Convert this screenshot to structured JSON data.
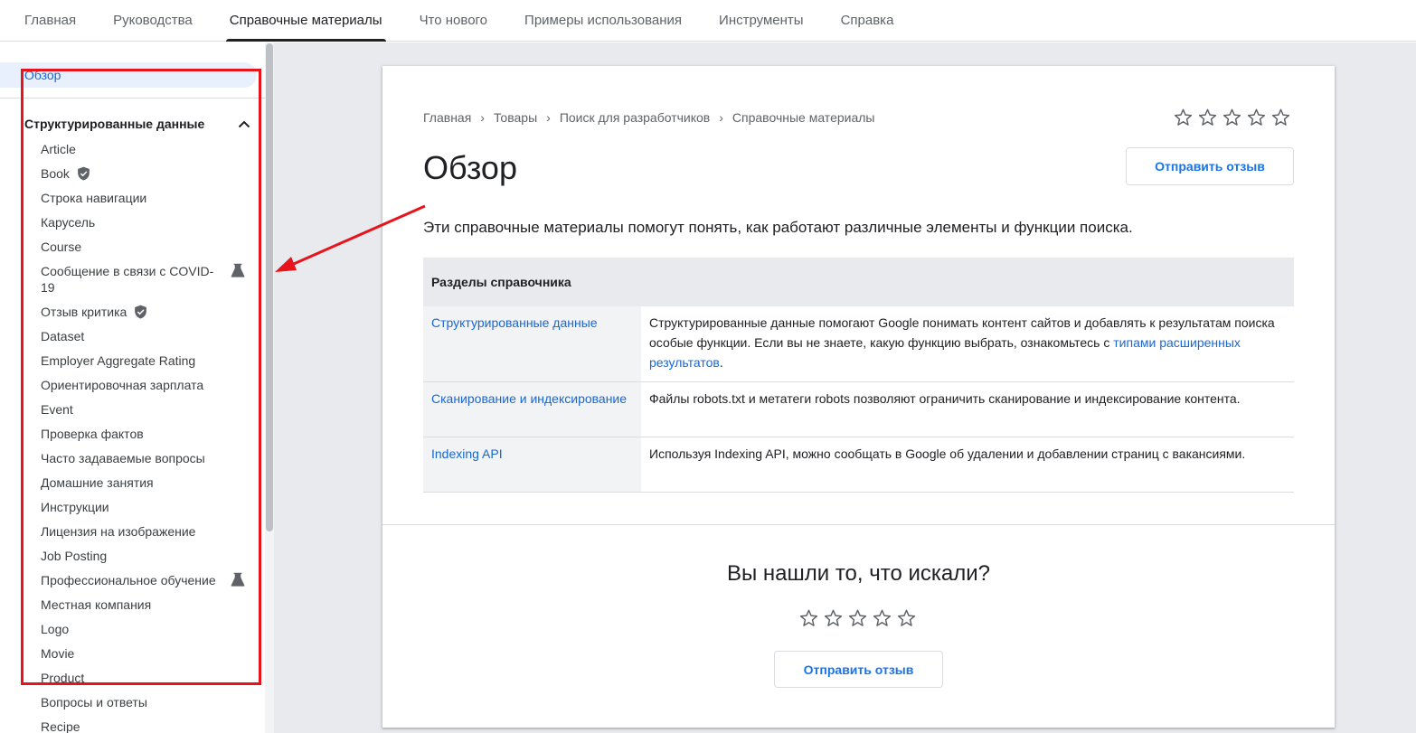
{
  "topnav": {
    "tabs": [
      {
        "label": "Главная",
        "active": false
      },
      {
        "label": "Руководства",
        "active": false
      },
      {
        "label": "Справочные материалы",
        "active": true
      },
      {
        "label": "Что нового",
        "active": false
      },
      {
        "label": "Примеры использования",
        "active": false
      },
      {
        "label": "Инструменты",
        "active": false
      },
      {
        "label": "Справка",
        "active": false
      }
    ]
  },
  "sidebar": {
    "overview_label": "Обзор",
    "section_title": "Структурированные данные",
    "items": [
      {
        "label": "Article",
        "icon": ""
      },
      {
        "label": "Book",
        "icon": "shield-check-icon"
      },
      {
        "label": "Строка навигации",
        "icon": ""
      },
      {
        "label": "Карусель",
        "icon": ""
      },
      {
        "label": "Course",
        "icon": ""
      },
      {
        "label": "Сообщение в связи с COVID-19",
        "icon": "beaker-icon"
      },
      {
        "label": "Отзыв критика",
        "icon": "shield-check-icon"
      },
      {
        "label": "Dataset",
        "icon": ""
      },
      {
        "label": "Employer Aggregate Rating",
        "icon": ""
      },
      {
        "label": "Ориентировочная зарплата",
        "icon": ""
      },
      {
        "label": "Event",
        "icon": ""
      },
      {
        "label": "Проверка фактов",
        "icon": ""
      },
      {
        "label": "Часто задаваемые вопросы",
        "icon": ""
      },
      {
        "label": "Домашние занятия",
        "icon": ""
      },
      {
        "label": "Инструкции",
        "icon": ""
      },
      {
        "label": "Лицензия на изображение",
        "icon": ""
      },
      {
        "label": "Job Posting",
        "icon": ""
      },
      {
        "label": "Профессиональное обучение",
        "icon": "beaker-icon"
      },
      {
        "label": "Местная компания",
        "icon": ""
      },
      {
        "label": "Logo",
        "icon": ""
      },
      {
        "label": "Movie",
        "icon": ""
      },
      {
        "label": "Product",
        "icon": ""
      },
      {
        "label": "Вопросы и ответы",
        "icon": ""
      },
      {
        "label": "Recipe",
        "icon": ""
      }
    ]
  },
  "breadcrumb": [
    "Главная",
    "Товары",
    "Поиск для разработчиков",
    "Справочные материалы"
  ],
  "page": {
    "title": "Обзор",
    "feedback_label": "Отправить отзыв",
    "intro": "Эти справочные материалы помогут понять, как работают различные элементы и функции поиска."
  },
  "table": {
    "header": "Разделы справочника",
    "rows": [
      {
        "key": "Структурированные данные",
        "desc": "Структурированные данные помогают Google понимать контент сайтов и добавлять к результатам поиска особые функции. Если вы не знаете, какую функцию выбрать, ознакомьтесь с ",
        "link": "типами расширенных результатов",
        "desc_end": "."
      },
      {
        "key": "Сканирование и индексирование",
        "desc": "Файлы robots.txt и метатеги robots позволяют ограничить сканирование и индексирование контента.",
        "link": "",
        "desc_end": ""
      },
      {
        "key": "Indexing API",
        "desc": "Используя Indexing API, можно сообщать в Google об удалении и добавлении страниц с вакансиями.",
        "link": "",
        "desc_end": ""
      }
    ]
  },
  "footer": {
    "question": "Вы нашли то, что искали?",
    "feedback_label": "Отправить отзыв"
  },
  "colors": {
    "accent": "#1a73e8",
    "highlight": "#e8141b"
  }
}
